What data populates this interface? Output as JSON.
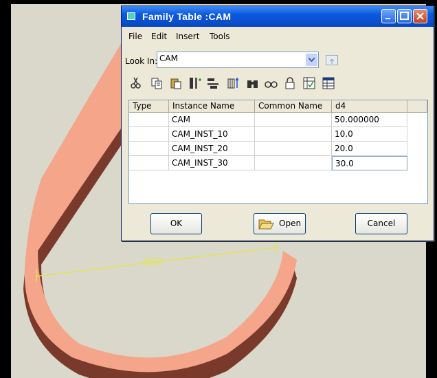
{
  "window": {
    "title": "Family Table :CAM"
  },
  "menu": {
    "items": [
      "File",
      "Edit",
      "Insert",
      "Tools"
    ]
  },
  "lookin": {
    "label": "Look In:",
    "value": "CAM"
  },
  "toolbar": {
    "icons": [
      "cut-icon",
      "copy-icon",
      "paste-icon",
      "add-column-icon",
      "add-row-icon",
      "insert-column-icon",
      "binoculars-icon",
      "glasses-icon",
      "lock-icon",
      "verify-icon",
      "table-properties-icon"
    ]
  },
  "table": {
    "headers": [
      "Type",
      "Instance Name",
      "Common Name",
      "d4"
    ],
    "rows": [
      [
        "",
        "CAM",
        "",
        "50.000000"
      ],
      [
        "",
        "CAM_INST_10",
        "",
        "10.0"
      ],
      [
        "",
        "CAM_INST_20",
        "",
        "20.0"
      ],
      [
        "",
        "CAM_INST_30",
        "",
        "30.0"
      ]
    ]
  },
  "buttons": {
    "ok": "OK",
    "open": "Open",
    "cancel": "Cancel"
  },
  "model": {
    "dimension_label": "Ø50"
  },
  "colors": {
    "title_bar": "#0b5ae0",
    "dialog_bg": "#ece9d8",
    "part_face": "#f4a58a",
    "part_side": "#7a3a2b",
    "background": "#d8d8cc",
    "dimension": "#e3e35a"
  }
}
